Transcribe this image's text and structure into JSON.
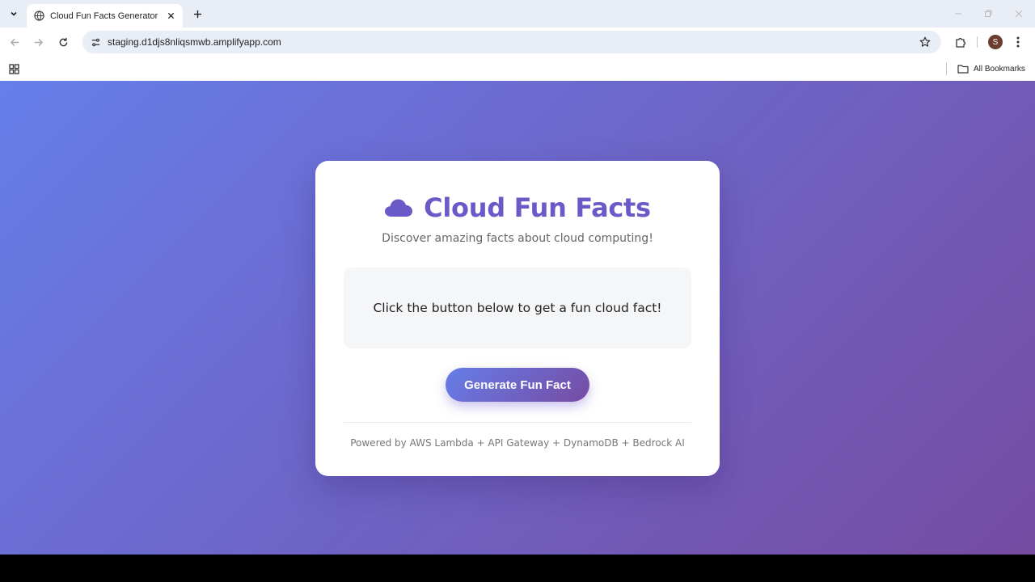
{
  "browser": {
    "tab_title": "Cloud Fun Facts Generator",
    "url": "staging.d1djs8nliqsmwb.amplifyapp.com",
    "profile_initial": "S",
    "all_bookmarks_label": "All Bookmarks"
  },
  "app": {
    "title": "Cloud Fun Facts",
    "subtitle": "Discover amazing facts about cloud computing!",
    "fact_placeholder": "Click the button below to get a fun cloud fact!",
    "generate_button": "Generate Fun Fact",
    "footer": "Powered by AWS Lambda + API Gateway + DynamoDB + Bedrock AI"
  },
  "colors": {
    "gradient_start": "#667eea",
    "gradient_end": "#764ba2",
    "title": "#6a5ac8"
  },
  "icons": {
    "title_icon": "cloud-icon"
  }
}
